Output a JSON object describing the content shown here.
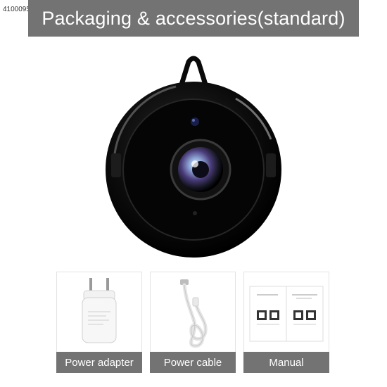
{
  "sku": "4100095",
  "banner": {
    "title": "Packaging & accessories(standard)"
  },
  "accessories": [
    {
      "label": "Power adapter"
    },
    {
      "label": "Power cable"
    },
    {
      "label": "Manual"
    }
  ]
}
